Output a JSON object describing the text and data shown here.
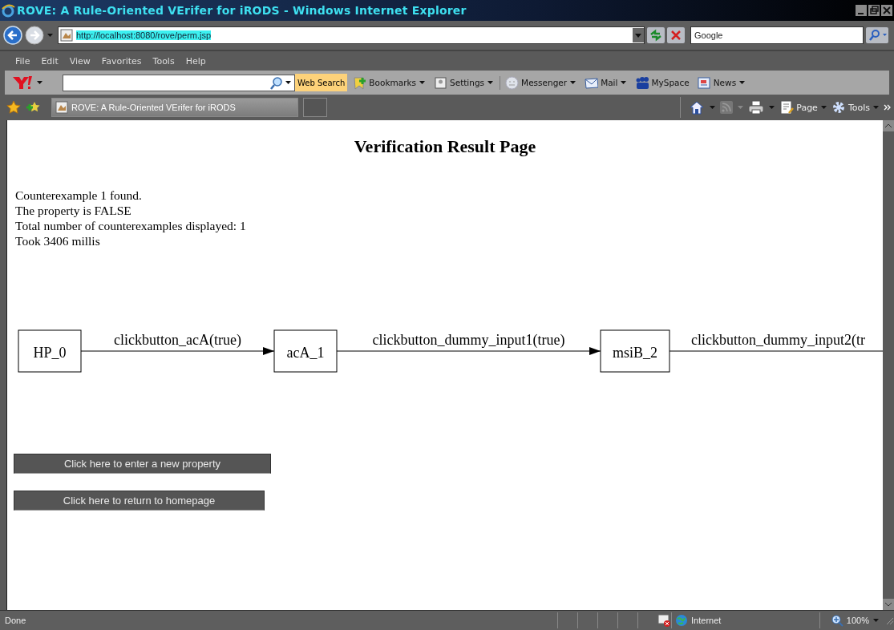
{
  "window": {
    "title": "ROVE: A Rule-Oriented VErifer for iRODS - Windows Internet Explorer"
  },
  "address_bar": {
    "url": "http://localhost:8080/rove/perm.jsp"
  },
  "search_box": {
    "value": "Google"
  },
  "menu": [
    "File",
    "Edit",
    "View",
    "Favorites",
    "Tools",
    "Help"
  ],
  "yahoo_toolbar": {
    "search_button": "Web Search",
    "items": [
      {
        "label": "Bookmarks",
        "kind": "bookmarks"
      },
      {
        "label": "Settings",
        "kind": "settings"
      },
      {
        "label": "Messenger",
        "kind": "messenger"
      },
      {
        "label": "Mail",
        "kind": "mail"
      },
      {
        "label": "MySpace",
        "kind": "myspace"
      },
      {
        "label": "News",
        "kind": "news"
      }
    ]
  },
  "tabs": [
    {
      "label": "ROVE: A Rule-Oriented VErifer for iRODS",
      "selected": true
    }
  ],
  "command_bar": [
    "Page",
    "Tools"
  ],
  "page": {
    "heading": "Verification Result Page",
    "lines": [
      "Counterexample 1 found.",
      "The property is FALSE",
      "Total number of counterexamples displayed: 1",
      "Took 3406 millis"
    ],
    "diagram": {
      "nodes": [
        "HP_0",
        "acA_1",
        "msiB_2"
      ],
      "edges": [
        "clickbutton_acA(true)",
        "clickbutton_dummy_input1(true)",
        "clickbutton_dummy_input2(tr"
      ]
    },
    "buttons": [
      "Click here to enter a new property",
      "Click here to return to homepage"
    ]
  },
  "status_bar": {
    "status": "Done",
    "zone": "Internet",
    "zoom": "100%"
  }
}
